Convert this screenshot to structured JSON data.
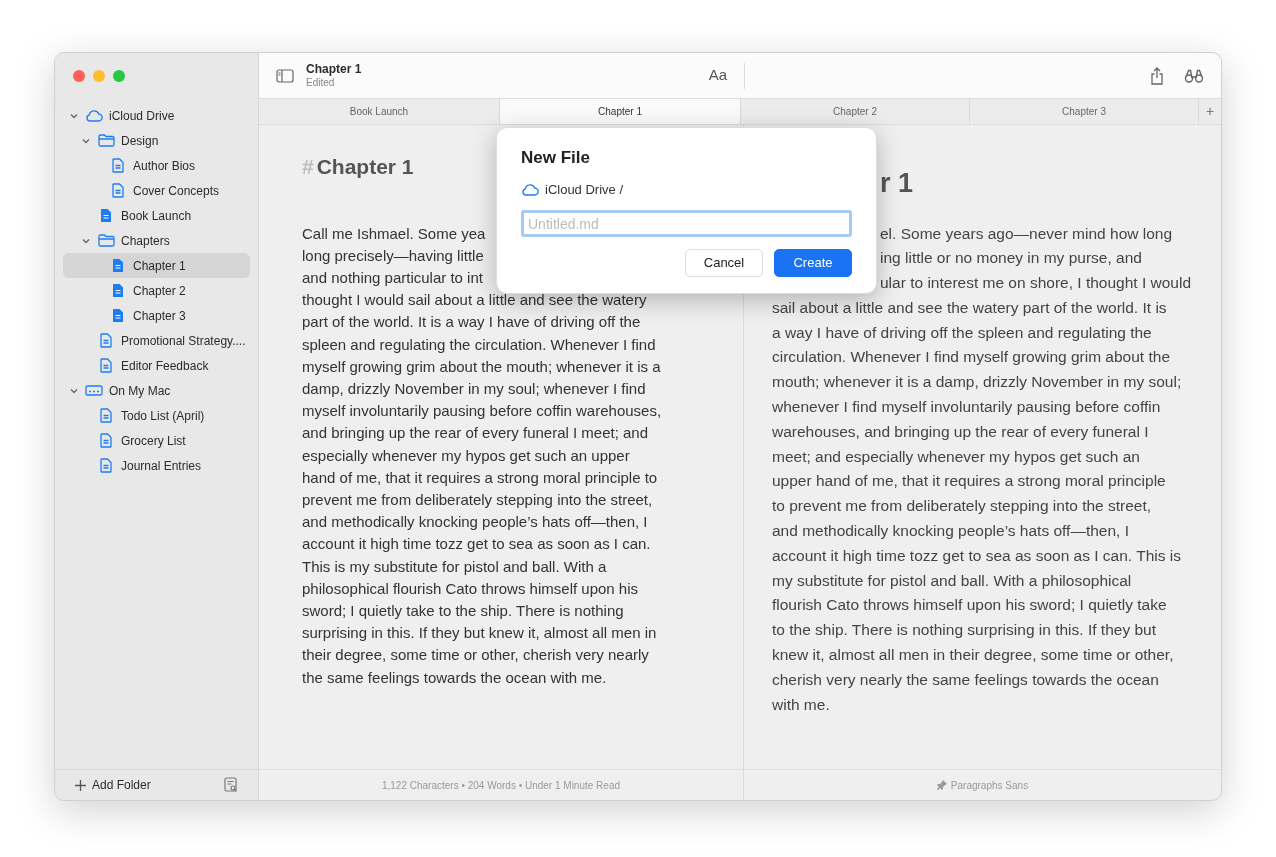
{
  "sidebar": {
    "tree": [
      {
        "label": "iCloud Drive",
        "kind": "cloud",
        "expanded": true,
        "selected": false,
        "children": [
          {
            "label": "Design",
            "kind": "folder",
            "expanded": true,
            "selected": false,
            "children": [
              {
                "label": "Author Bios",
                "kind": "doc",
                "selected": false
              },
              {
                "label": "Cover Concepts",
                "kind": "doc",
                "selected": false
              }
            ]
          },
          {
            "label": "Book Launch",
            "kind": "doc-filled",
            "selected": false
          },
          {
            "label": "Chapters",
            "kind": "folder",
            "expanded": true,
            "selected": false,
            "children": [
              {
                "label": "Chapter 1",
                "kind": "doc-filled",
                "selected": true
              },
              {
                "label": "Chapter 2",
                "kind": "doc-filled",
                "selected": false
              },
              {
                "label": "Chapter 3",
                "kind": "doc-filled",
                "selected": false
              }
            ]
          },
          {
            "label": "Promotional Strategy....",
            "kind": "doc",
            "selected": false
          },
          {
            "label": "Editor Feedback",
            "kind": "doc",
            "selected": false
          }
        ]
      },
      {
        "label": "On My Mac",
        "kind": "drive",
        "expanded": true,
        "selected": false,
        "children": [
          {
            "label": "Todo List (April)",
            "kind": "doc",
            "selected": false
          },
          {
            "label": "Grocery List",
            "kind": "doc",
            "selected": false
          },
          {
            "label": "Journal Entries",
            "kind": "doc",
            "selected": false
          }
        ]
      }
    ],
    "add_folder": "Add Folder"
  },
  "toolbar": {
    "title": "Chapter 1",
    "subtitle": "Edited",
    "font_button": "Aa"
  },
  "tabs": [
    {
      "label": "Book Launch",
      "selected": false
    },
    {
      "label": "Chapter 1",
      "selected": true
    },
    {
      "label": "Chapter 2",
      "selected": false
    },
    {
      "label": "Chapter 3",
      "selected": false
    }
  ],
  "new_tab": "+",
  "editor": {
    "heading_mark": "#",
    "heading": "Chapter 1",
    "lines": [
      "Call me Ishmael. Some yea",
      "long precisely—having little",
      "and nothing particular to int",
      "thought I would sail about a little and see the watery",
      "part of the world. It is a way I have of driving off the",
      "spleen and regulating the circulation. Whenever I find",
      "myself growing grim about the mouth; whenever it is a",
      "damp, drizzly November in my soul; whenever I find",
      "myself involuntarily pausing before coffin warehouses,",
      "and bringing up the rear of every funeral I meet; and",
      "especially whenever my hypos get such an upper",
      "hand of me, that it requires a strong moral principle to",
      "prevent me from deliberately stepping into the street,",
      "and methodically knocking people’s hats off—then, I",
      "account it high time tozz get to sea as soon as I can.",
      "This is my substitute for pistol and ball. With a",
      "philosophical flourish Cato throws himself upon his",
      "sword; I quietly take to the ship. There is nothing",
      "surprising in this. If they but knew it, almost all men in",
      "their degree, some time or other, cherish very nearly",
      "the same feelings towards the ocean with me."
    ],
    "status": "1,122 Characters • 204 Words • Under 1 Minute Read"
  },
  "preview": {
    "heading": "r 1",
    "covered_lines": [
      "el. Some years ago—never mind how long",
      "ing little or no money in my purse, and",
      "ular to interest me on shore, I thought I would"
    ],
    "lines": [
      "sail about a little and see the watery part of the world. It is",
      "a way I have of driving off the spleen and regulating the",
      "circulation. Whenever I find myself growing grim about the",
      "mouth; whenever it is a damp, drizzly November in my soul;",
      "whenever I find myself involuntarily pausing before coffin",
      "warehouses, and bringing up the rear of every funeral I",
      "meet; and especially whenever my hypos get such an",
      "upper hand of me, that it requires a strong moral principle",
      "to prevent me from deliberately stepping into the street,",
      "and methodically knocking people’s hats off—then, I",
      "account it high time tozz get to sea as soon as I can. This is",
      "my substitute for pistol and ball. With a philosophical",
      "flourish Cato throws himself upon his sword; I quietly take",
      "to the ship. There is nothing surprising in this. If they but",
      "knew it, almost all men in their degree, some time or other,",
      "cherish very nearly the same feelings towards the ocean",
      "with me."
    ],
    "status": "Paragraphs Sans"
  },
  "dialog": {
    "title": "New File",
    "location": "iCloud Drive /",
    "placeholder": "Untitled.md",
    "buttons": [
      {
        "label": "Cancel",
        "kind": "secondary"
      },
      {
        "label": "Create",
        "kind": "primary"
      }
    ]
  }
}
